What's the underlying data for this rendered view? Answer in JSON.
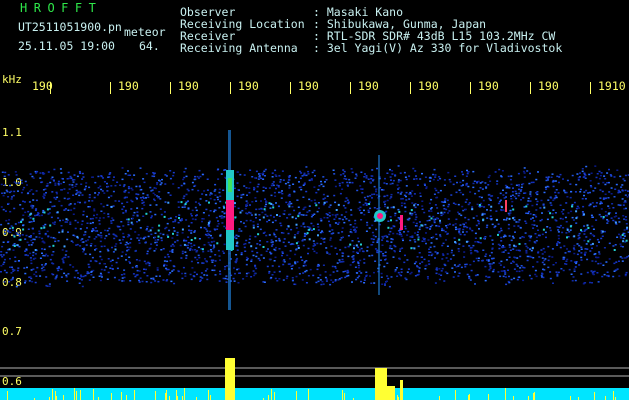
{
  "header": {
    "app_title": "HROFFT",
    "filename": "UT2511051900.pn",
    "mode": "meteor",
    "datetime": "25.11.05 19:00",
    "count": "64."
  },
  "station": {
    "observer_label": "Observer",
    "observer_value": ": Masaki Kano",
    "location_label": "Receiving Location",
    "location_value": ": Shibukawa, Gunma, Japan",
    "receiver_label": "Receiver",
    "receiver_value": ": RTL-SDR SDR# 43dB L15 103.2MHz CW",
    "antenna_label": "Receiving Antenna",
    "antenna_value": ": 3el Yagi(V) Az 330 for Vladivostok"
  },
  "axis": {
    "unit_label": "kHz",
    "x_ticks": [
      "190",
      "190",
      "190",
      "190",
      "190",
      "190",
      "190",
      "190",
      "190",
      "1910"
    ],
    "y_ticks": [
      "1.1",
      "1.0",
      "0.9",
      "0.8",
      "0.7",
      "0.6"
    ]
  },
  "colors": {
    "background": "#000000",
    "text": "#c8f0f0",
    "title": "#2ee84a",
    "axis": "#ffff66",
    "noise_floor": "#00e5ff"
  }
}
